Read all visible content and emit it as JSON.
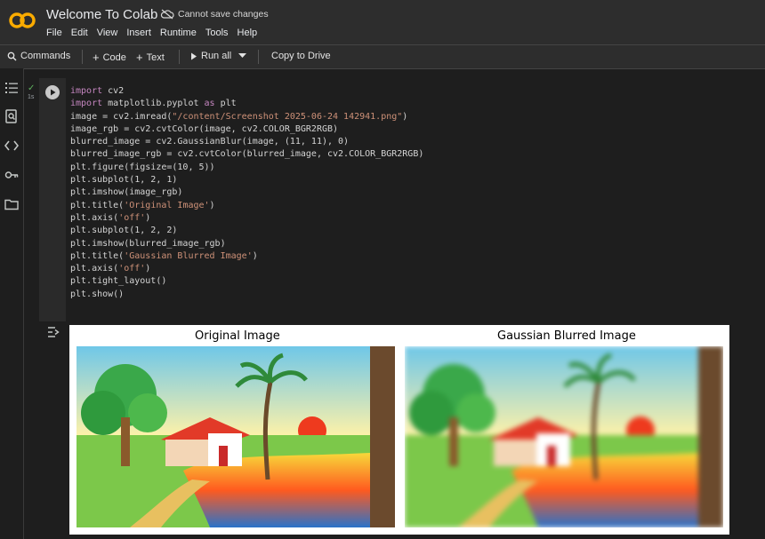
{
  "header": {
    "title": "Welcome To Colab",
    "save_status": "Cannot save changes",
    "menu": [
      "File",
      "Edit",
      "View",
      "Insert",
      "Runtime",
      "Tools",
      "Help"
    ]
  },
  "toolbar": {
    "commands": "Commands",
    "code": "Code",
    "text": "Text",
    "run_all": "Run all",
    "copy_to_drive": "Copy to Drive"
  },
  "cell": {
    "exec_time": "1s",
    "lines": [
      "import cv2",
      "import matplotlib.pyplot as plt",
      "image = cv2.imread(\"/content/Screenshot 2025-06-24 142941.png\")",
      "image_rgb = cv2.cvtColor(image, cv2.COLOR_BGR2RGB)",
      "blurred_image = cv2.GaussianBlur(image, (11, 11), 0)",
      "blurred_image_rgb = cv2.cvtColor(blurred_image, cv2.COLOR_BGR2RGB)",
      "plt.figure(figsize=(10, 5))",
      "plt.subplot(1, 2, 1)",
      "plt.imshow(image_rgb)",
      "plt.title('Original Image')",
      "plt.axis('off')",
      "plt.subplot(1, 2, 2)",
      "plt.imshow(blurred_image_rgb)",
      "plt.title('Gaussian Blurred Image')",
      "plt.axis('off')",
      "plt.tight_layout()",
      "plt.show()"
    ]
  },
  "output": {
    "left_title": "Original Image",
    "right_title": "Gaussian Blurred Image"
  },
  "colors": {
    "accent": "#f9ab00",
    "bg": "#1e1e1e"
  }
}
